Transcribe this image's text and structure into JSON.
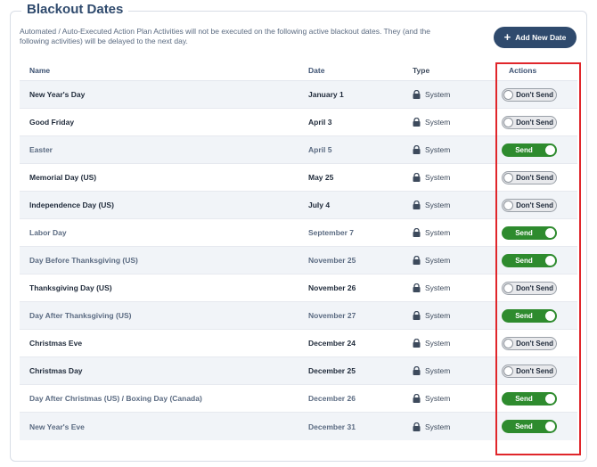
{
  "title": "Blackout Dates",
  "description": "Automated / Auto-Executed Action Plan Activities will not be executed on the following active blackout dates. They (and the following activities) will be delayed to the next day.",
  "add_button": "Add New Date",
  "columns": {
    "name": "Name",
    "date": "Date",
    "type": "Type",
    "actions": "Actions"
  },
  "colors": {
    "send_on": "#2e8b2e",
    "header_text": "#2f4a6d",
    "highlight": "#e0262b"
  },
  "rows": [
    {
      "name": "New Year's Day",
      "date": "January 1",
      "type": "System",
      "action": "Don't Send",
      "send": false
    },
    {
      "name": "Good Friday",
      "date": "April 3",
      "type": "System",
      "action": "Don't Send",
      "send": false
    },
    {
      "name": "Easter",
      "date": "April 5",
      "type": "System",
      "action": "Send",
      "send": true
    },
    {
      "name": "Memorial Day (US)",
      "date": "May 25",
      "type": "System",
      "action": "Don't Send",
      "send": false
    },
    {
      "name": "Independence Day (US)",
      "date": "July 4",
      "type": "System",
      "action": "Don't Send",
      "send": false
    },
    {
      "name": "Labor Day",
      "date": "September 7",
      "type": "System",
      "action": "Send",
      "send": true
    },
    {
      "name": "Day Before Thanksgiving (US)",
      "date": "November 25",
      "type": "System",
      "action": "Send",
      "send": true
    },
    {
      "name": "Thanksgiving Day (US)",
      "date": "November 26",
      "type": "System",
      "action": "Don't Send",
      "send": false
    },
    {
      "name": "Day After Thanksgiving (US)",
      "date": "November 27",
      "type": "System",
      "action": "Send",
      "send": true
    },
    {
      "name": "Christmas Eve",
      "date": "December 24",
      "type": "System",
      "action": "Don't Send",
      "send": false
    },
    {
      "name": "Christmas Day",
      "date": "December 25",
      "type": "System",
      "action": "Don't Send",
      "send": false
    },
    {
      "name": "Day After Christmas (US) / Boxing Day (Canada)",
      "date": "December 26",
      "type": "System",
      "action": "Send",
      "send": true
    },
    {
      "name": "New Year's Eve",
      "date": "December 31",
      "type": "System",
      "action": "Send",
      "send": true
    }
  ]
}
